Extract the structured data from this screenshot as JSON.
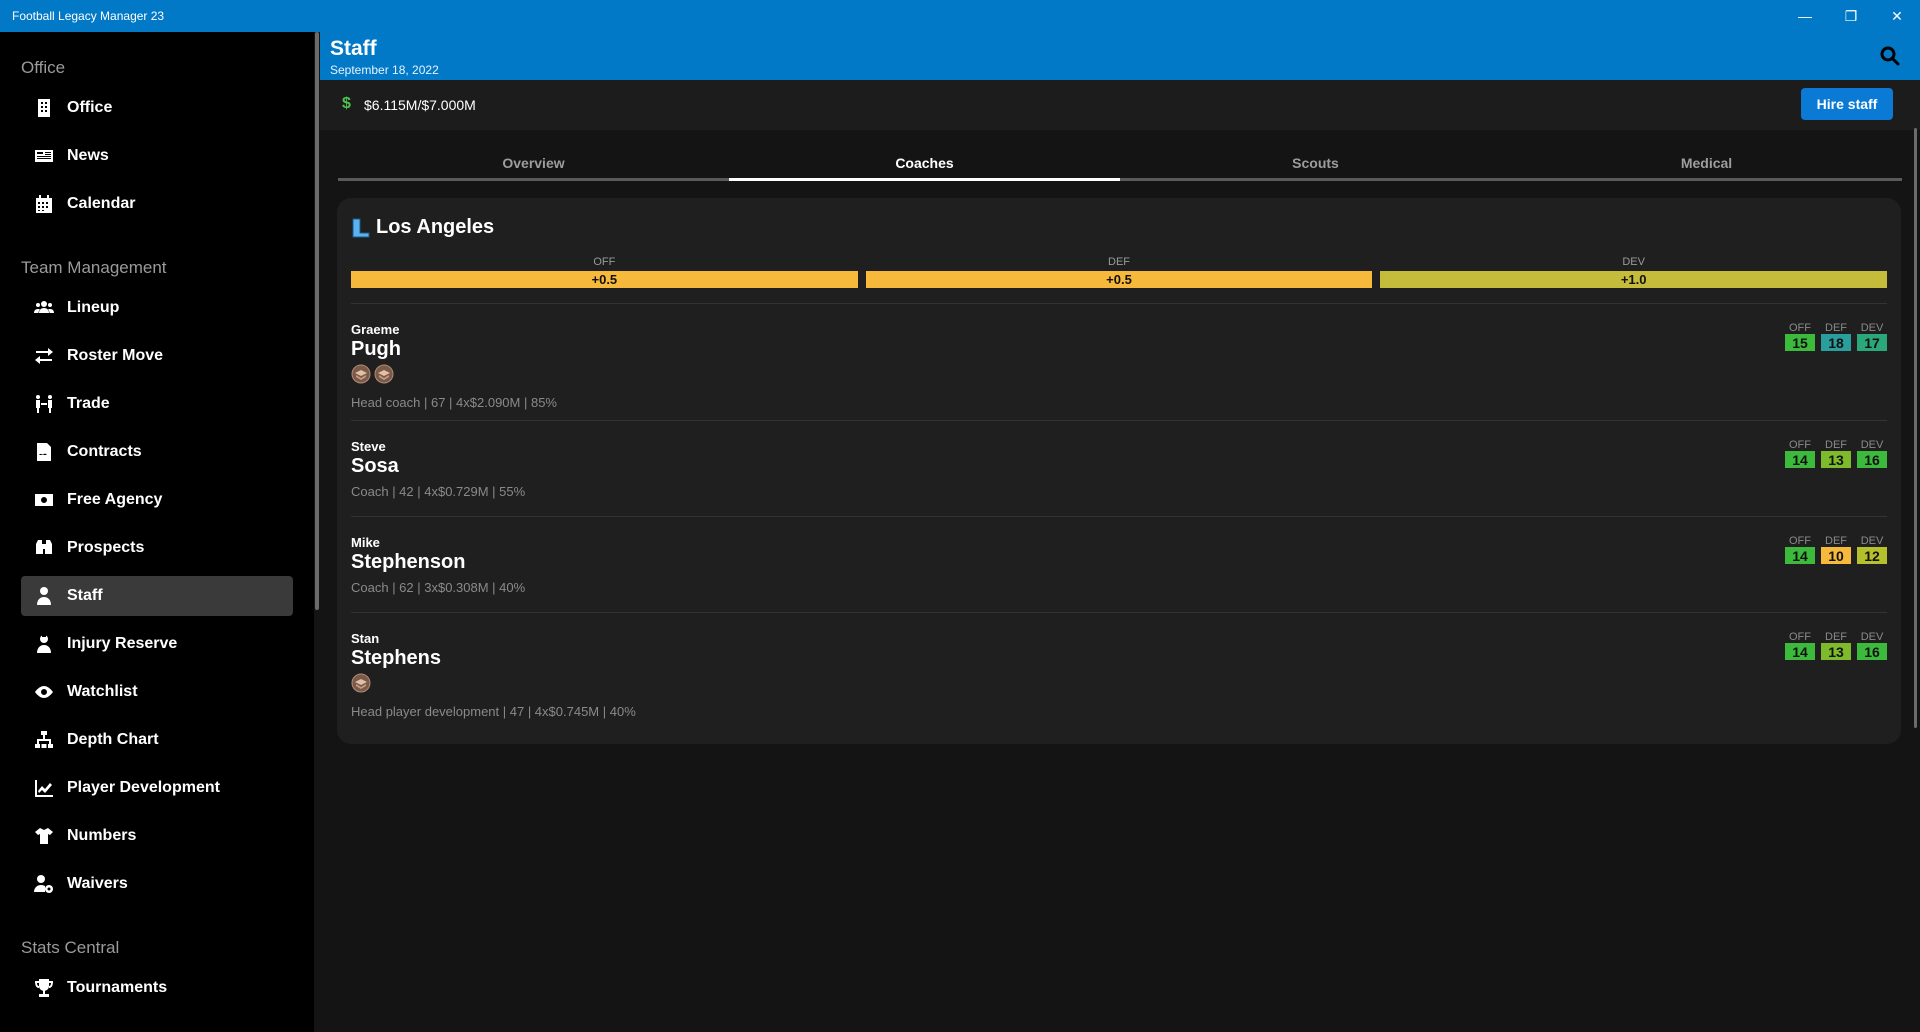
{
  "window": {
    "title": "Football Legacy Manager 23",
    "minimize": "—",
    "restore": "❐",
    "close": "✕"
  },
  "sidebar": {
    "sections": [
      {
        "title": "Office",
        "items": [
          {
            "label": "Office",
            "icon": "building-icon"
          },
          {
            "label": "News",
            "icon": "newspaper-icon"
          },
          {
            "label": "Calendar",
            "icon": "calendar-icon"
          }
        ]
      },
      {
        "title": "Team Management",
        "items": [
          {
            "label": "Lineup",
            "icon": "users-icon"
          },
          {
            "label": "Roster Move",
            "icon": "arrows-exchange-icon"
          },
          {
            "label": "Trade",
            "icon": "trade-icon"
          },
          {
            "label": "Contracts",
            "icon": "contract-icon"
          },
          {
            "label": "Free Agency",
            "icon": "money-icon"
          },
          {
            "label": "Prospects",
            "icon": "binoculars-icon"
          },
          {
            "label": "Staff",
            "icon": "staff-icon",
            "active": true
          },
          {
            "label": "Injury Reserve",
            "icon": "injury-icon"
          },
          {
            "label": "Watchlist",
            "icon": "eye-icon"
          },
          {
            "label": "Depth Chart",
            "icon": "sitemap-icon"
          },
          {
            "label": "Player Development",
            "icon": "chart-line-icon"
          },
          {
            "label": "Numbers",
            "icon": "jersey-icon"
          },
          {
            "label": "Waivers",
            "icon": "user-cog-icon"
          }
        ]
      },
      {
        "title": "Stats Central",
        "items": [
          {
            "label": "Tournaments",
            "icon": "trophy-icon"
          }
        ]
      }
    ]
  },
  "header": {
    "title": "Staff",
    "date": "September 18, 2022"
  },
  "budget": {
    "symbol": "$",
    "text": "$6.115M/$7.000M",
    "hire_label": "Hire staff"
  },
  "tabs": [
    {
      "label": "Overview",
      "active": false
    },
    {
      "label": "Coaches",
      "active": true
    },
    {
      "label": "Scouts",
      "active": false
    },
    {
      "label": "Medical",
      "active": false
    }
  ],
  "team": {
    "name": "Los Angeles",
    "logo_letter": "L",
    "ratings": [
      {
        "label": "OFF",
        "value": "+0.5",
        "color": "#f6b93b"
      },
      {
        "label": "DEF",
        "value": "+0.5",
        "color": "#f6b93b"
      },
      {
        "label": "DEV",
        "value": "+1.0",
        "color": "#c4bc3a"
      }
    ]
  },
  "staff": [
    {
      "first": "Graeme",
      "last": "Pugh",
      "badges": 2,
      "info": "Head coach | 67 | 4x$2.090M | 85%",
      "stats": [
        {
          "label": "OFF",
          "value": "15",
          "color": "#3cba3c"
        },
        {
          "label": "DEF",
          "value": "18",
          "color": "#2a9d9d"
        },
        {
          "label": "DEV",
          "value": "17",
          "color": "#2aa87a"
        }
      ]
    },
    {
      "first": "Steve",
      "last": "Sosa",
      "badges": 0,
      "info": "Coach | 42 | 4x$0.729M | 55%",
      "stats": [
        {
          "label": "OFF",
          "value": "14",
          "color": "#3cba3c"
        },
        {
          "label": "DEF",
          "value": "13",
          "color": "#7dbb2a"
        },
        {
          "label": "DEV",
          "value": "16",
          "color": "#3cba3c"
        }
      ]
    },
    {
      "first": "Mike",
      "last": "Stephenson",
      "badges": 0,
      "info": "Coach | 62 | 3x$0.308M | 40%",
      "stats": [
        {
          "label": "OFF",
          "value": "14",
          "color": "#3cba3c"
        },
        {
          "label": "DEF",
          "value": "10",
          "color": "#f6b93b"
        },
        {
          "label": "DEV",
          "value": "12",
          "color": "#b6c02a"
        }
      ]
    },
    {
      "first": "Stan",
      "last": "Stephens",
      "badges": 1,
      "info": "Head player development | 47 | 4x$0.745M | 40%",
      "stats": [
        {
          "label": "OFF",
          "value": "14",
          "color": "#3cba3c"
        },
        {
          "label": "DEF",
          "value": "13",
          "color": "#7dbb2a"
        },
        {
          "label": "DEV",
          "value": "16",
          "color": "#3cba3c"
        }
      ]
    }
  ]
}
